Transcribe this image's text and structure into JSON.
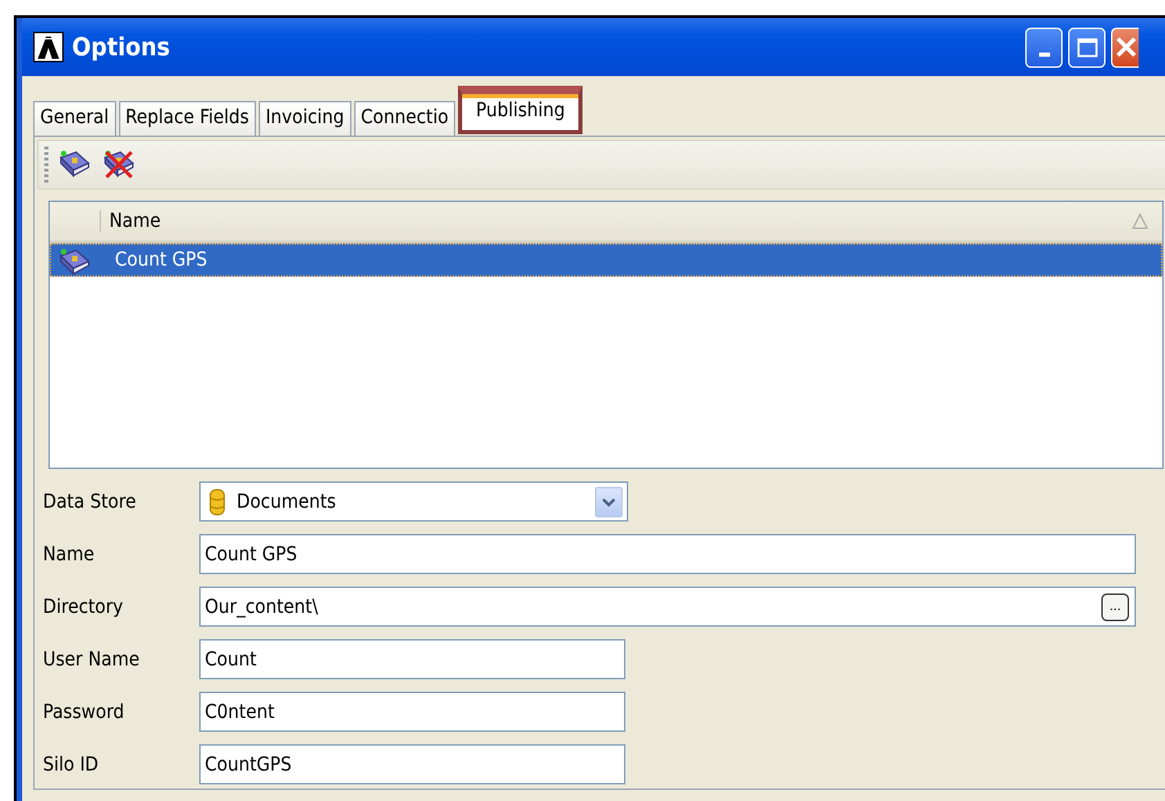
{
  "window": {
    "title": "Options"
  },
  "tabs": [
    {
      "label": "General",
      "selected": false
    },
    {
      "label": "Replace Fields",
      "selected": false
    },
    {
      "label": "Invoicing",
      "selected": false
    },
    {
      "label": "Connectio",
      "selected": false
    },
    {
      "label": "Publishing",
      "selected": true
    }
  ],
  "list": {
    "columns": [
      "Name"
    ],
    "rows": [
      {
        "name": "Count GPS",
        "selected": true
      }
    ]
  },
  "fields": [
    {
      "kind": "combo",
      "label": "Data Store",
      "value": "Documents"
    },
    {
      "kind": "text",
      "label": "Name",
      "value": "Count GPS",
      "wide": true
    },
    {
      "kind": "browse",
      "label": "Directory",
      "value": "Our_content\\",
      "button": "..."
    },
    {
      "kind": "text",
      "label": "User Name",
      "value": "Count",
      "wide": false
    },
    {
      "kind": "text",
      "label": "Password",
      "value": "C0ntent",
      "wide": false
    },
    {
      "kind": "text",
      "label": "Silo ID",
      "value": "CountGPS",
      "wide": false
    }
  ]
}
